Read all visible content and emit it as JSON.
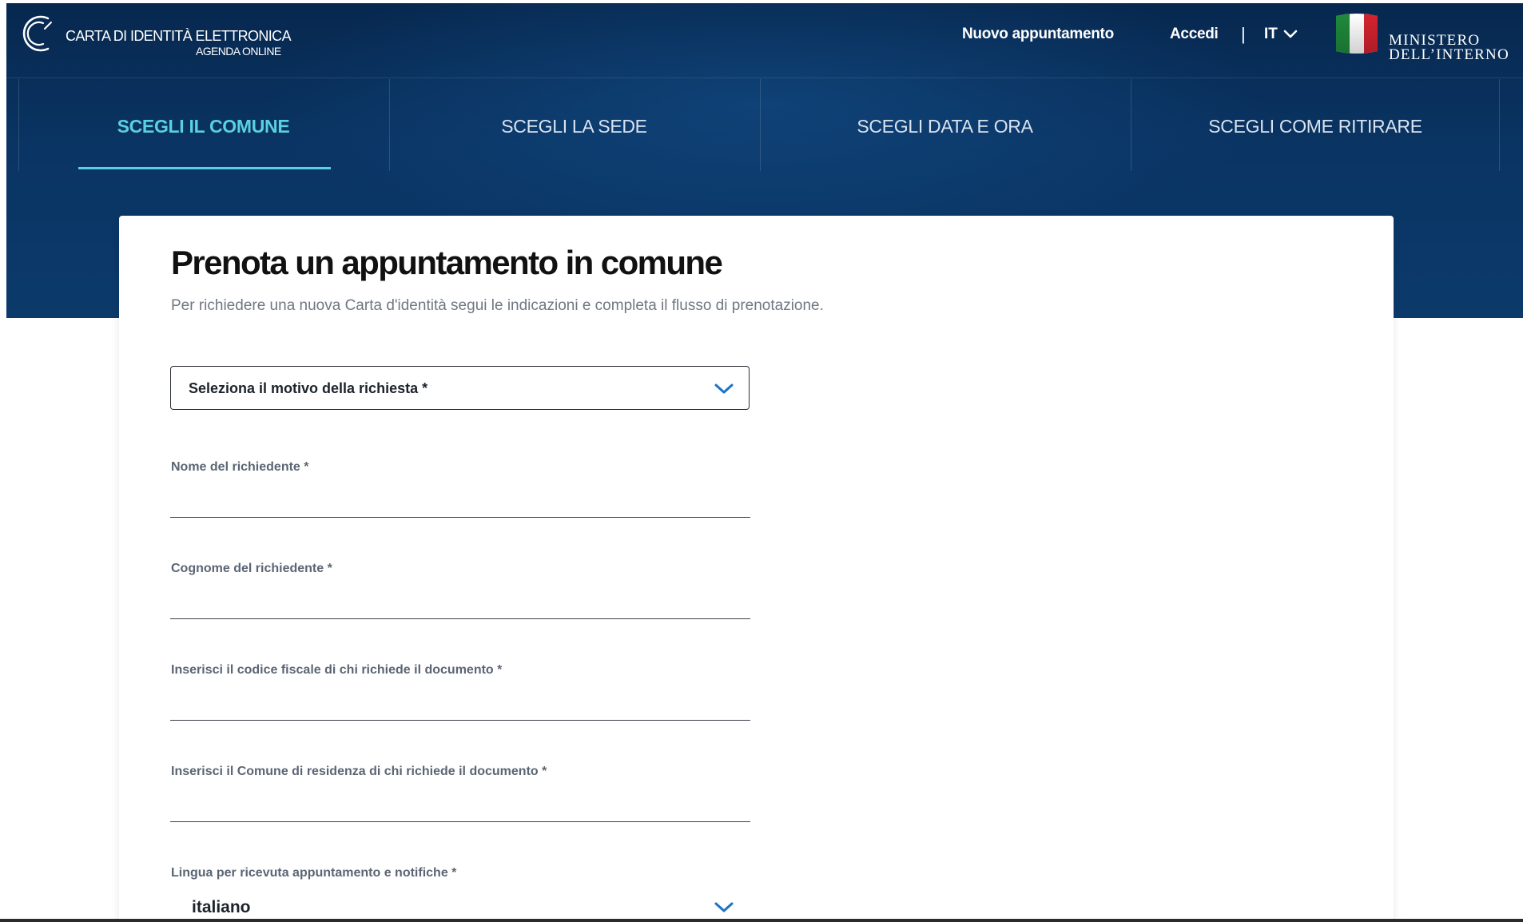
{
  "brand": {
    "line1": "CARTA DI IDENTITÀ ELETTRONICA",
    "line2": "AGENDA ONLINE"
  },
  "nav": {
    "new_appointment": "Nuovo appuntamento",
    "login": "Accedi",
    "separator": "|",
    "language": "IT"
  },
  "ministry": {
    "line1": "MINISTERO",
    "line2": "DELL’INTERNO"
  },
  "steps": [
    {
      "label": "SCEGLI IL COMUNE",
      "active": true
    },
    {
      "label": "SCEGLI LA SEDE",
      "active": false
    },
    {
      "label": "SCEGLI DATA E ORA",
      "active": false
    },
    {
      "label": "SCEGLI COME RITIRARE",
      "active": false
    }
  ],
  "form": {
    "title": "Prenota un appuntamento in comune",
    "subtitle": "Per richiedere una nuova Carta d'identità segui le indicazioni e completa il flusso di prenotazione.",
    "reason_select": {
      "label": "Seleziona il motivo della richiesta *"
    },
    "fields": [
      {
        "label": "Nome del richiedente *",
        "value": ""
      },
      {
        "label": "Cognome del richiedente *",
        "value": ""
      },
      {
        "label": "Inserisci il codice fiscale di chi richiede il documento *",
        "value": ""
      },
      {
        "label": "Inserisci il Comune di residenza di chi richiede il documento *",
        "value": ""
      }
    ],
    "language_select": {
      "label": "Lingua per ricevuta appuntamento e notifiche *",
      "value": "italiano"
    }
  },
  "colors": {
    "header_bg": "#0a3463",
    "accent": "#5ad0e0",
    "chevron": "#1a73c9"
  },
  "icons": {
    "brand": "cie-logo-icon",
    "language_dropdown": "chevron-down-icon",
    "flag": "italian-flag-icon",
    "select_dropdown": "chevron-down-icon"
  }
}
